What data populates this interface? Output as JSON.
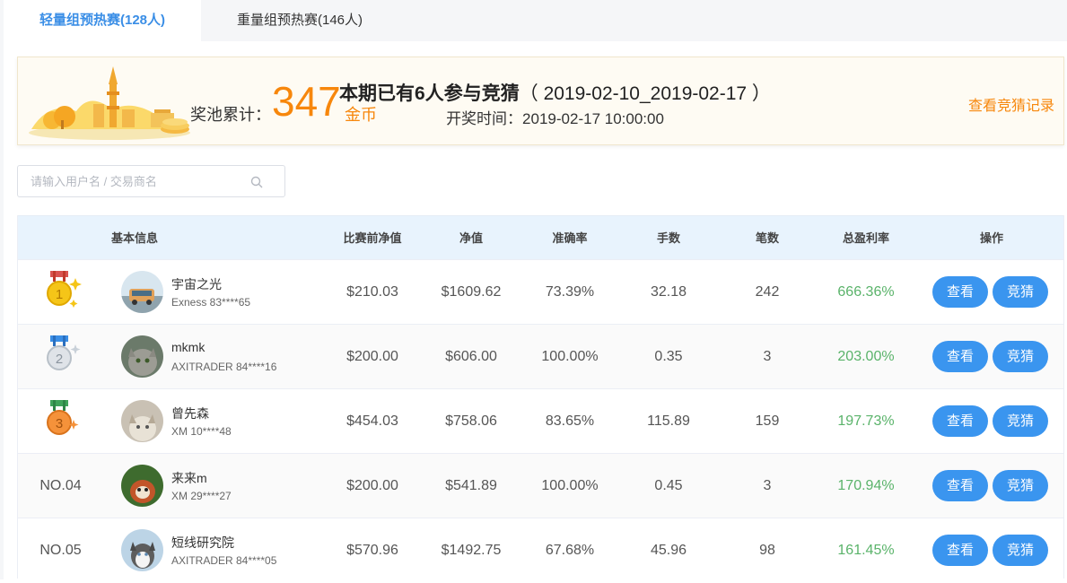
{
  "tabs": [
    {
      "label": "轻量组预热赛(128人)",
      "active": true
    },
    {
      "label": "重量组预热赛(146人)",
      "active": false
    }
  ],
  "banner": {
    "pool_label": "奖池累计：",
    "pool_amount": "347",
    "pool_unit": "金币",
    "headline_bold": "本期已有6人参与竞猜",
    "headline_period": "（ 2019-02-10_2019-02-17 ）",
    "draw_time": "开奖时间：2019-02-17 10:00:00",
    "records_link": "查看竞猜记录"
  },
  "search": {
    "placeholder": "请输入用户名 / 交易商名",
    "value": ""
  },
  "table": {
    "headers": {
      "basic": "基本信息",
      "pre_net": "比赛前净值",
      "net": "净值",
      "accuracy": "准确率",
      "lots": "手数",
      "trades": "笔数",
      "profit": "总盈利率",
      "action": "操作"
    },
    "rows": [
      {
        "rank": "1",
        "name": "宇宙之光",
        "broker": "Exness 83****65",
        "pre_net": "$210.03",
        "net": "$1609.62",
        "accuracy": "73.39%",
        "lots": "32.18",
        "trades": "242",
        "profit": "666.36%"
      },
      {
        "rank": "2",
        "name": "mkmk",
        "broker": "AXITRADER 84****16",
        "pre_net": "$200.00",
        "net": "$606.00",
        "accuracy": "100.00%",
        "lots": "0.35",
        "trades": "3",
        "profit": "203.00%"
      },
      {
        "rank": "3",
        "name": "曾先森",
        "broker": "XM 10****48",
        "pre_net": "$454.03",
        "net": "$758.06",
        "accuracy": "83.65%",
        "lots": "115.89",
        "trades": "159",
        "profit": "197.73%"
      },
      {
        "rank": "NO.04",
        "name": "来来m",
        "broker": "XM 29****27",
        "pre_net": "$200.00",
        "net": "$541.89",
        "accuracy": "100.00%",
        "lots": "0.45",
        "trades": "3",
        "profit": "170.94%"
      },
      {
        "rank": "NO.05",
        "name": "短线研究院",
        "broker": "AXITRADER 84****05",
        "pre_net": "$570.96",
        "net": "$1492.75",
        "accuracy": "67.68%",
        "lots": "45.96",
        "trades": "98",
        "profit": "161.45%"
      }
    ],
    "view_label": "查看",
    "guess_label": "竞猜"
  },
  "colors": {
    "accent_blue": "#3a95ef",
    "gold": "#f7870c",
    "profit_green": "#5ab36a",
    "header_bg": "#e8f3fd"
  }
}
